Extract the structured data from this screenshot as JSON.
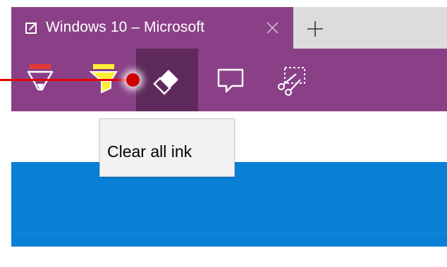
{
  "tab": {
    "title": "Windows 10 – Microsoft",
    "icon": "edit-note-icon",
    "close_icon": "close-icon"
  },
  "newtab": {
    "icon": "plus-icon"
  },
  "toolbar": {
    "tools": [
      {
        "name": "ballpoint-pen",
        "icon": "pen-icon",
        "color": "#e53935"
      },
      {
        "name": "highlighter",
        "icon": "highlighter-icon",
        "color": "#ffee33"
      },
      {
        "name": "eraser",
        "icon": "eraser-icon",
        "active": true
      },
      {
        "name": "add-note",
        "icon": "comment-icon"
      },
      {
        "name": "clip",
        "icon": "clip-scissors-icon"
      }
    ]
  },
  "tooltip": {
    "text": "Clear all ink"
  },
  "colors": {
    "accent_purple": "#8a4087",
    "active_tool": "#5e2a5c",
    "content_blue": "#0a7fd6",
    "pointer_red": "#d10000"
  }
}
